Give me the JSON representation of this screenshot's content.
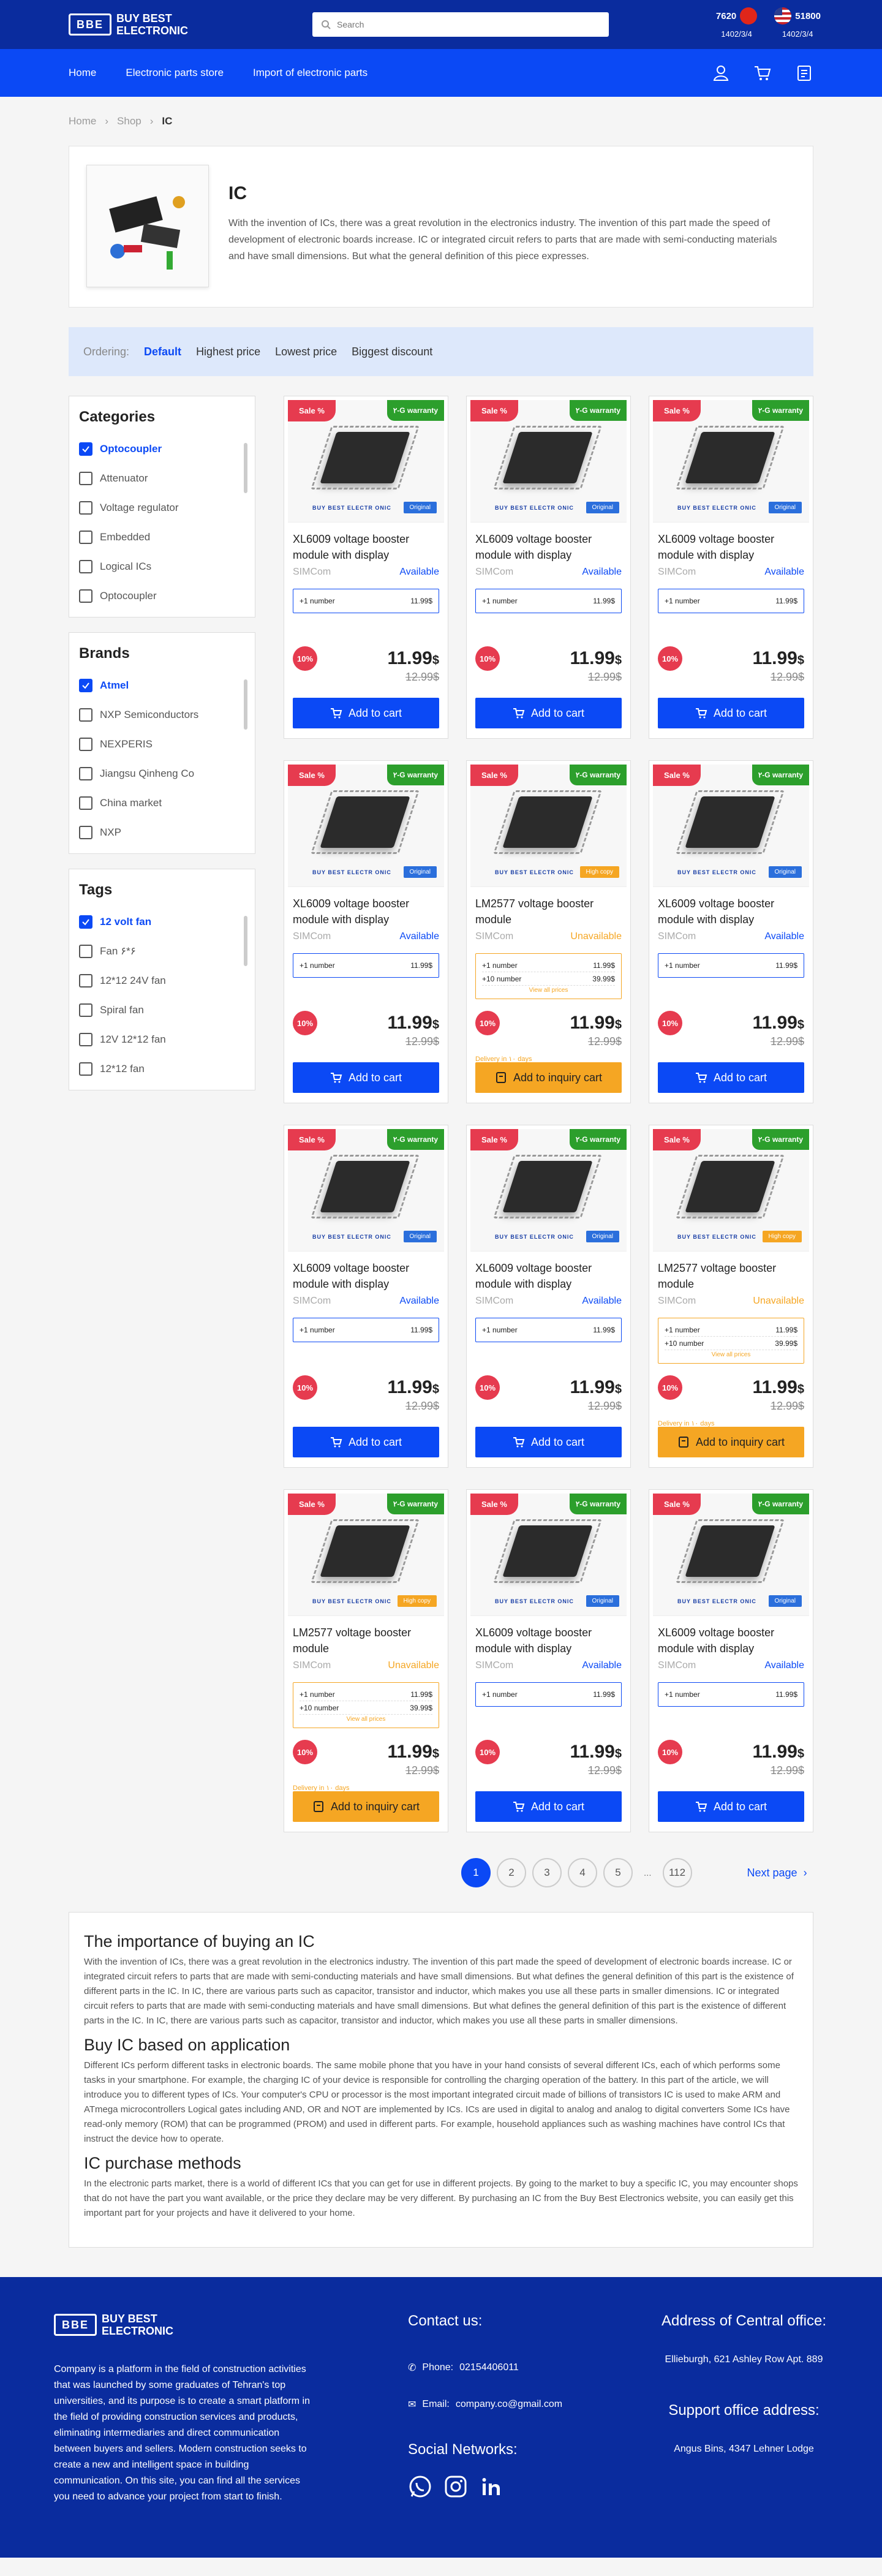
{
  "header": {
    "logo_top": "BUY BEST",
    "logo_bottom": "ELECTRONIC",
    "search_placeholder": "Search",
    "rates": [
      {
        "value": "7620",
        "date": "1402/3/4"
      },
      {
        "value": "51800",
        "date": "1402/3/4"
      }
    ]
  },
  "nav": {
    "items": [
      "Home",
      "Electronic parts store",
      "Import of electronic parts"
    ]
  },
  "breadcrumb": [
    "Home",
    "Shop",
    "IC"
  ],
  "intro": {
    "title": "IC",
    "text": "With the invention of ICs, there was a great revolution in the electronics industry. The invention of this part made the speed of development of electronic boards increase. IC or integrated circuit refers to parts that are made with semi-conducting materials and have small dimensions. But what the general definition of this piece expresses."
  },
  "ordering": {
    "label": "Ordering:",
    "options": [
      "Default",
      "Highest price",
      "Lowest price",
      "Biggest discount"
    ],
    "selected": "Default"
  },
  "filters": {
    "categories": {
      "title": "Categories",
      "items": [
        "Optocoupler",
        "Attenuator",
        "Voltage regulator",
        "Embedded",
        "Logical ICs",
        "Optocoupler"
      ]
    },
    "brands": {
      "title": "Brands",
      "items": [
        "Atmel",
        "NXP Semiconductors",
        "NEXPERIS",
        "Jiangsu Qinheng Co",
        "China market",
        "NXP"
      ]
    },
    "tags": {
      "title": "Tags",
      "items": [
        "12 volt fan",
        "Fan ۶*۶",
        "12*12 24V fan",
        "Spiral fan",
        "12V 12*12 fan",
        "12*12 fan"
      ]
    }
  },
  "products": [
    {
      "name": "XL6009 voltage booster module with display",
      "mfr": "SIMCom",
      "status": "Available",
      "type": "cart",
      "tag": "Original"
    },
    {
      "name": "XL6009 voltage booster module with display",
      "mfr": "SIMCom",
      "status": "Available",
      "type": "cart",
      "tag": "Original"
    },
    {
      "name": "XL6009 voltage booster module with display",
      "mfr": "SIMCom",
      "status": "Available",
      "type": "cart",
      "tag": "Original"
    },
    {
      "name": "XL6009 voltage booster module with display",
      "mfr": "SIMCom",
      "status": "Available",
      "type": "cart",
      "tag": "Original"
    },
    {
      "name": "LM2577 voltage booster module",
      "mfr": "SIMCom",
      "status": "Unavailable",
      "type": "inquiry",
      "tag": "High copy"
    },
    {
      "name": "XL6009 voltage booster module with display",
      "mfr": "SIMCom",
      "status": "Available",
      "type": "cart",
      "tag": "Original"
    },
    {
      "name": "XL6009 voltage booster module with display",
      "mfr": "SIMCom",
      "status": "Available",
      "type": "cart",
      "tag": "Original"
    },
    {
      "name": "XL6009 voltage booster module with display",
      "mfr": "SIMCom",
      "status": "Available",
      "type": "cart",
      "tag": "Original"
    },
    {
      "name": "LM2577 voltage booster module",
      "mfr": "SIMCom",
      "status": "Unavailable",
      "type": "inquiry",
      "tag": "High copy"
    },
    {
      "name": "LM2577 voltage booster module",
      "mfr": "SIMCom",
      "status": "Unavailable",
      "type": "inquiry",
      "tag": "High copy"
    },
    {
      "name": "XL6009 voltage booster module with display",
      "mfr": "SIMCom",
      "status": "Available",
      "type": "cart",
      "tag": "Original"
    },
    {
      "name": "XL6009 voltage booster module with display",
      "mfr": "SIMCom",
      "status": "Available",
      "type": "cart",
      "tag": "Original"
    }
  ],
  "product_common": {
    "sale": "Sale %",
    "warranty": "۲-G warranty",
    "brand_strip": "BUY BEST ELECTR ONIC",
    "qty1": "+1 number",
    "qty10": "+10 number",
    "price_small": "11.99$",
    "price_small10": "39.99$",
    "view_all": "View all prices",
    "discount": "10%",
    "price": "11.99",
    "currency": "$",
    "old_price": "12.99$",
    "delivery": "Delivery in ۱۰ days",
    "cart_label": "Add to cart",
    "inquiry_label": "Add to inquiry cart"
  },
  "pagination": {
    "pages": [
      "1",
      "2",
      "3",
      "4",
      "5"
    ],
    "ellipsis": "...",
    "last": "112",
    "next": "Next page"
  },
  "article": [
    {
      "heading": "The importance of buying an IC",
      "text": "With the invention of ICs, there was a great revolution in the electronics industry. The invention of this part made the speed of development of electronic boards increase. IC or integrated circuit refers to parts that are made with semi-conducting materials and have small dimensions. But what defines the general definition of this part is the existence of different parts in the IC. In IC, there are various parts such as capacitor, transistor and inductor, which makes you use all these parts in smaller dimensions. IC or integrated circuit refers to parts that are made with semi-conducting materials and have small dimensions. But what defines the general definition of this part is the existence of different parts in the IC. In IC, there are various parts such as capacitor, transistor and inductor, which makes you use all these parts in smaller dimensions."
    },
    {
      "heading": "Buy IC based on application",
      "text": "Different ICs perform different tasks in electronic boards. The same mobile phone that you have in your hand consists of several different ICs, each of which performs some tasks in your smartphone. For example, the charging IC of your device is responsible for controlling the charging operation of the battery. In this part of the article, we will introduce you to different types of ICs. Your computer's CPU or processor is the most important integrated circuit made of billions of transistors IC is used to make ARM and ATmega microcontrollers Logical gates including AND, OR and NOT are implemented by ICs. ICs are used in digital to analog and analog to digital converters Some ICs have read-only memory (ROM) that can be programmed (PROM) and used in different parts. For example, household appliances such as washing machines have control ICs that instruct the device how to operate."
    },
    {
      "heading": "IC purchase methods",
      "text": "In the electronic parts market, there is a world of different ICs that you can get for use in different projects. By going to the market to buy a specific IC, you may encounter shops that do not have the part you want available, or the price they declare may be very different. By purchasing an IC from the Buy Best Electronics website, you can easily get this important part for your projects and have it delivered to your home."
    }
  ],
  "footer": {
    "about": "Company is a platform in the field of construction activities that was launched by some graduates of Tehran's top universities, and its purpose is to create a smart platform in the field of providing construction services and products, eliminating intermediaries and direct communication between buyers and sellers. Modern construction seeks to create a new and intelligent space in building communication. On this site, you can find all the services you need to advance your project from start to finish.",
    "contact_title": "Contact us:",
    "phone_label": "Phone:",
    "phone": "02154406011",
    "email_label": "Email:",
    "email": "company.co@gmail.com",
    "social_title": "Social Networks:",
    "central_title": "Address of Central office:",
    "central_addr": "Ellieburgh, 621 Ashley Row Apt. 889",
    "support_title": "Support office address:",
    "support_addr": "Angus Bins, 4347 Lehner Lodge"
  },
  "colors": {
    "primary": "#0b49f5",
    "dark": "#0a2c9e",
    "sale": "#e63b4f",
    "warranty": "#2c9f2c",
    "inquiry": "#f5a623"
  }
}
